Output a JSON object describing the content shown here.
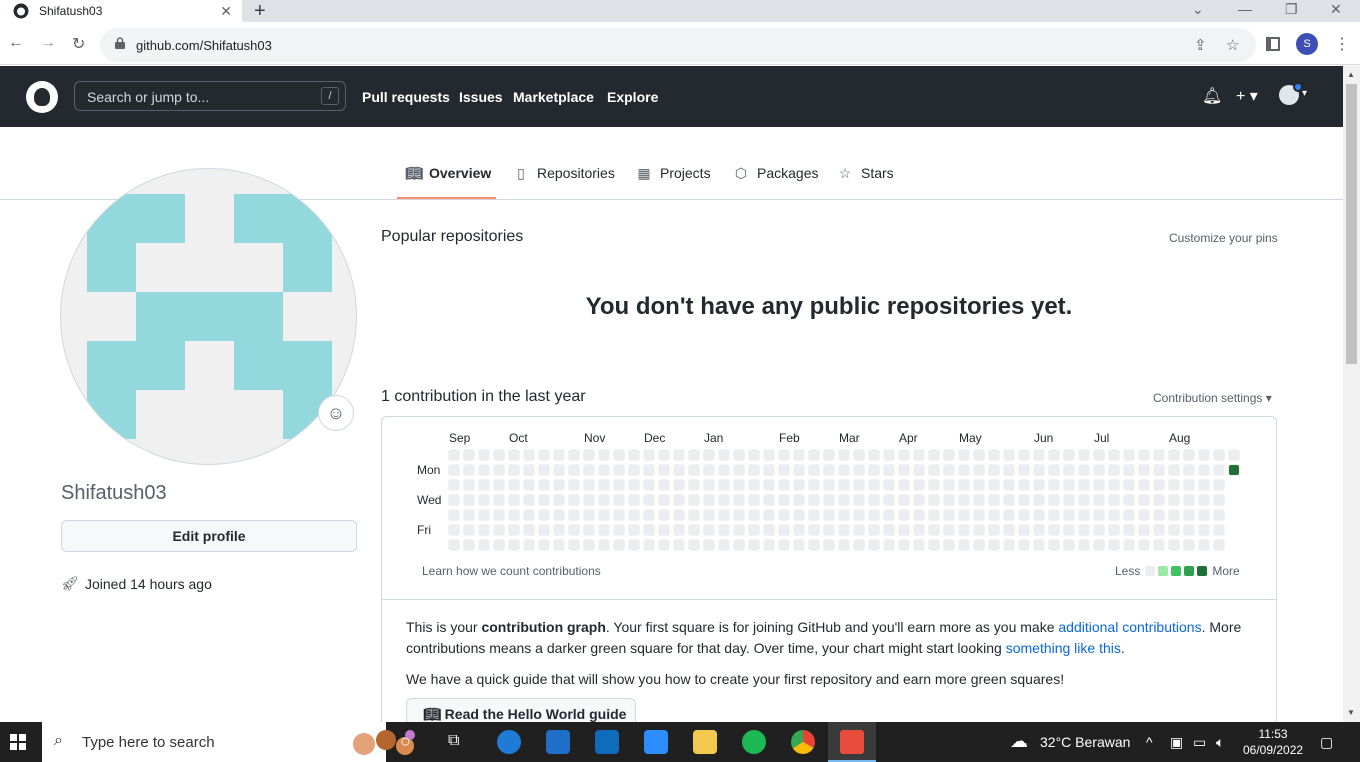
{
  "browser": {
    "tab_title": "Shifatush03",
    "url": "github.com/Shifatush03",
    "profile_initial": "S"
  },
  "github_header": {
    "search_placeholder": "Search or jump to...",
    "search_shortcut": "/",
    "nav": [
      "Pull requests",
      "Issues",
      "Marketplace",
      "Explore"
    ]
  },
  "profile_tabs": [
    {
      "label": "Overview",
      "icon": "book-icon",
      "selected": true
    },
    {
      "label": "Repositories",
      "icon": "repo-icon",
      "selected": false
    },
    {
      "label": "Projects",
      "icon": "table-icon",
      "selected": false
    },
    {
      "label": "Packages",
      "icon": "package-icon",
      "selected": false
    },
    {
      "label": "Stars",
      "icon": "star-icon",
      "selected": false
    }
  ],
  "sidebar": {
    "username": "Shifatush03",
    "edit_profile": "Edit profile",
    "joined": "Joined 14 hours ago"
  },
  "main": {
    "popular_title": "Popular repositories",
    "customize_pins": "Customize your pins",
    "no_repos": "You don't have any public repositories yet.",
    "contrib_title": "1 contribution in the last year",
    "contrib_settings": "Contribution settings ▾",
    "months": [
      "Sep",
      "Oct",
      "Nov",
      "Dec",
      "Jan",
      "Feb",
      "Mar",
      "Apr",
      "May",
      "Jun",
      "Jul",
      "Aug"
    ],
    "days": [
      "Mon",
      "Wed",
      "Fri"
    ],
    "learn_link": "Learn how we count contributions",
    "legend_less": "Less",
    "legend_more": "More",
    "info_p1_a": "This is your ",
    "info_p1_bold": "contribution graph",
    "info_p1_b": ". Your first square is for joining GitHub and you'll earn more as you make ",
    "info_p1_link1": "additional contributions",
    "info_p1_c": ". More contributions means a darker green square for that day. Over time, your chart might start looking ",
    "info_p1_link2": "something like this",
    "info_p1_d": ".",
    "info_p2": "We have a quick guide that will show you how to create your first repository and earn more green squares!",
    "guide_button": "Read the Hello World guide"
  },
  "taskbar": {
    "search_placeholder": "Type here to search",
    "weather": "32°C  Berawan",
    "time": "11:53",
    "date": "06/09/2022"
  },
  "colors": {
    "accent_link": "#0969da",
    "header_bg": "#24292f",
    "contrib_levels": [
      "#ebedf0",
      "#9be9a8",
      "#40c463",
      "#30a14e",
      "#216e39"
    ]
  }
}
